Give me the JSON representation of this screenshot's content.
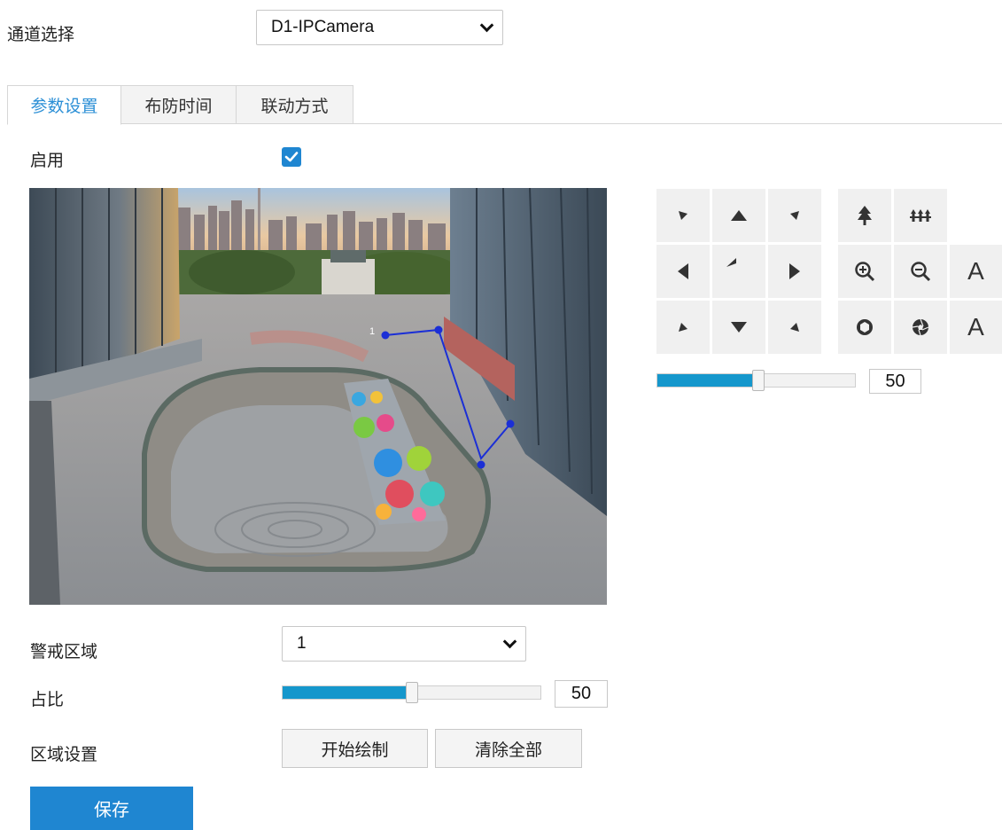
{
  "channel": {
    "label": "通道选择",
    "value": "D1-IPCamera"
  },
  "tabs": [
    {
      "label": "参数设置",
      "active": true
    },
    {
      "label": "布防时间",
      "active": false
    },
    {
      "label": "联动方式",
      "active": false
    }
  ],
  "enable": {
    "label": "启用",
    "checked": true
  },
  "ptz": {
    "buttons": [
      {
        "name": "ptz-up-left",
        "icon": "arrow-up-left-icon"
      },
      {
        "name": "ptz-up",
        "icon": "arrow-up-icon"
      },
      {
        "name": "ptz-up-right",
        "icon": "arrow-up-right-icon"
      },
      {
        "name": "ptz-focus-far",
        "icon": "tree-icon"
      },
      {
        "name": "ptz-focus-near",
        "icon": "grass-icon"
      },
      {
        "name": "ptz-left",
        "icon": "arrow-left-icon"
      },
      {
        "name": "ptz-reset",
        "icon": "return-arrow-icon"
      },
      {
        "name": "ptz-right",
        "icon": "arrow-right-icon"
      },
      {
        "name": "ptz-zoom-in",
        "icon": "zoom-in-icon"
      },
      {
        "name": "ptz-zoom-out",
        "icon": "zoom-out-icon"
      },
      {
        "name": "ptz-auto-focus",
        "icon": "letter-a-icon",
        "text": "A"
      },
      {
        "name": "ptz-down-left",
        "icon": "arrow-down-left-icon"
      },
      {
        "name": "ptz-down",
        "icon": "arrow-down-icon"
      },
      {
        "name": "ptz-down-right",
        "icon": "arrow-down-right-icon"
      },
      {
        "name": "ptz-iris-open",
        "icon": "iris-open-icon"
      },
      {
        "name": "ptz-iris-close",
        "icon": "iris-close-icon"
      },
      {
        "name": "ptz-auto-iris",
        "icon": "letter-a-icon",
        "text": "A"
      }
    ],
    "speed": 50,
    "speed_fraction": 0.5
  },
  "zone": {
    "label": "警戒区域",
    "value": "1"
  },
  "ratio": {
    "label": "占比",
    "value": 50,
    "fraction": 0.5
  },
  "area": {
    "label": "区域设置",
    "start_label": "开始绘制",
    "clear_label": "清除全部"
  },
  "save_label": "保存",
  "colors": {
    "accent": "#1f86d1",
    "slider": "#1597cc",
    "region_line": "#1b2fd6"
  }
}
